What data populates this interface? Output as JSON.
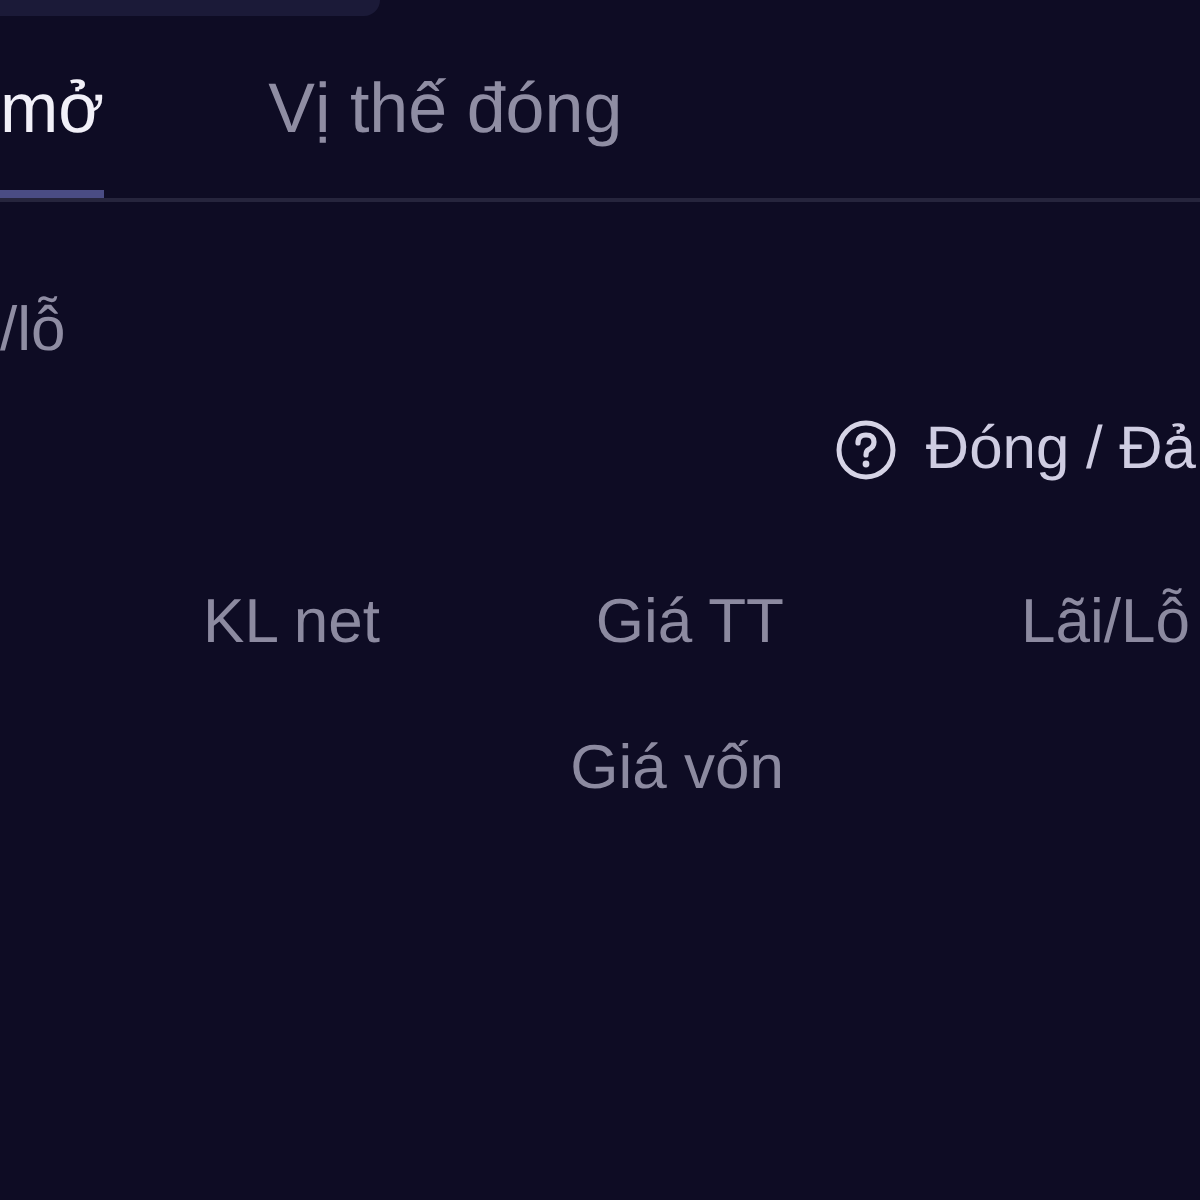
{
  "tabs": [
    {
      "label": "mở",
      "selected": true
    },
    {
      "label": "Vị thế đóng",
      "selected": false
    }
  ],
  "pnl_label": "/lỗ",
  "close_reverse_button": {
    "label": "Đóng / Đả"
  },
  "table": {
    "columns": [
      {
        "label": "KL net"
      },
      {
        "label": "Giá TT",
        "sublabel": "Giá vốn"
      },
      {
        "label": "Lãi/Lỗ"
      }
    ]
  }
}
